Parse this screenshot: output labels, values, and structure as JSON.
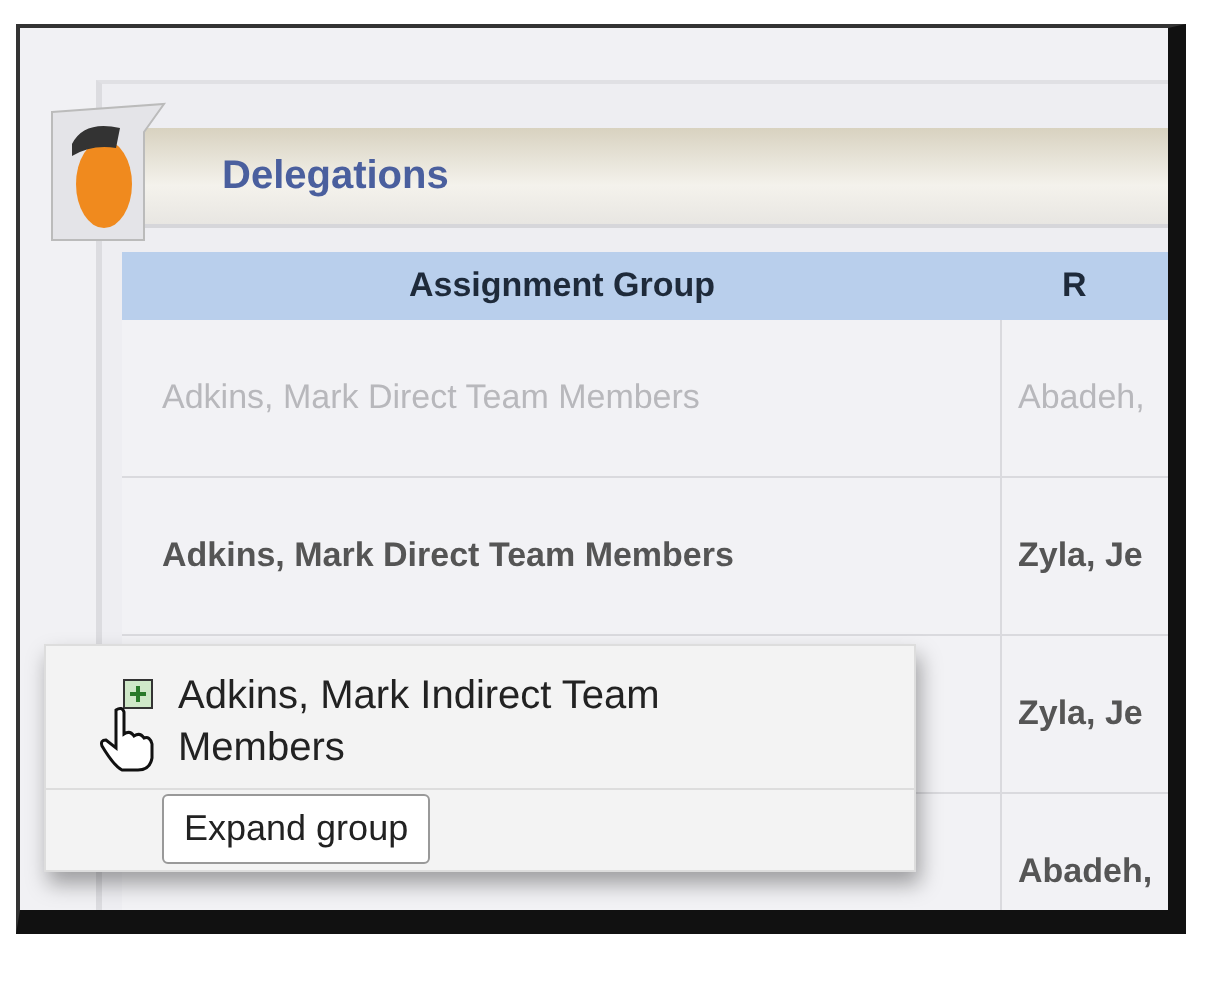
{
  "panel": {
    "title": "Delegations"
  },
  "table": {
    "columns": [
      "Assignment Group",
      "R"
    ],
    "rows": [
      {
        "group": "Adkins, Mark Direct Team Members",
        "column_2": "Abadeh,",
        "dimmed": true
      },
      {
        "group": "Adkins, Mark Direct Team Members",
        "column_2": "Zyla, Je",
        "dimmed": false
      },
      {
        "column_2": "Zyla, Je",
        "dimmed": false
      },
      {
        "column_2": "Abadeh,",
        "dimmed": false
      }
    ]
  },
  "hover_popup": {
    "group": "Adkins, Mark Indirect Team Members",
    "expanded": false,
    "tooltip": "Expand group"
  }
}
